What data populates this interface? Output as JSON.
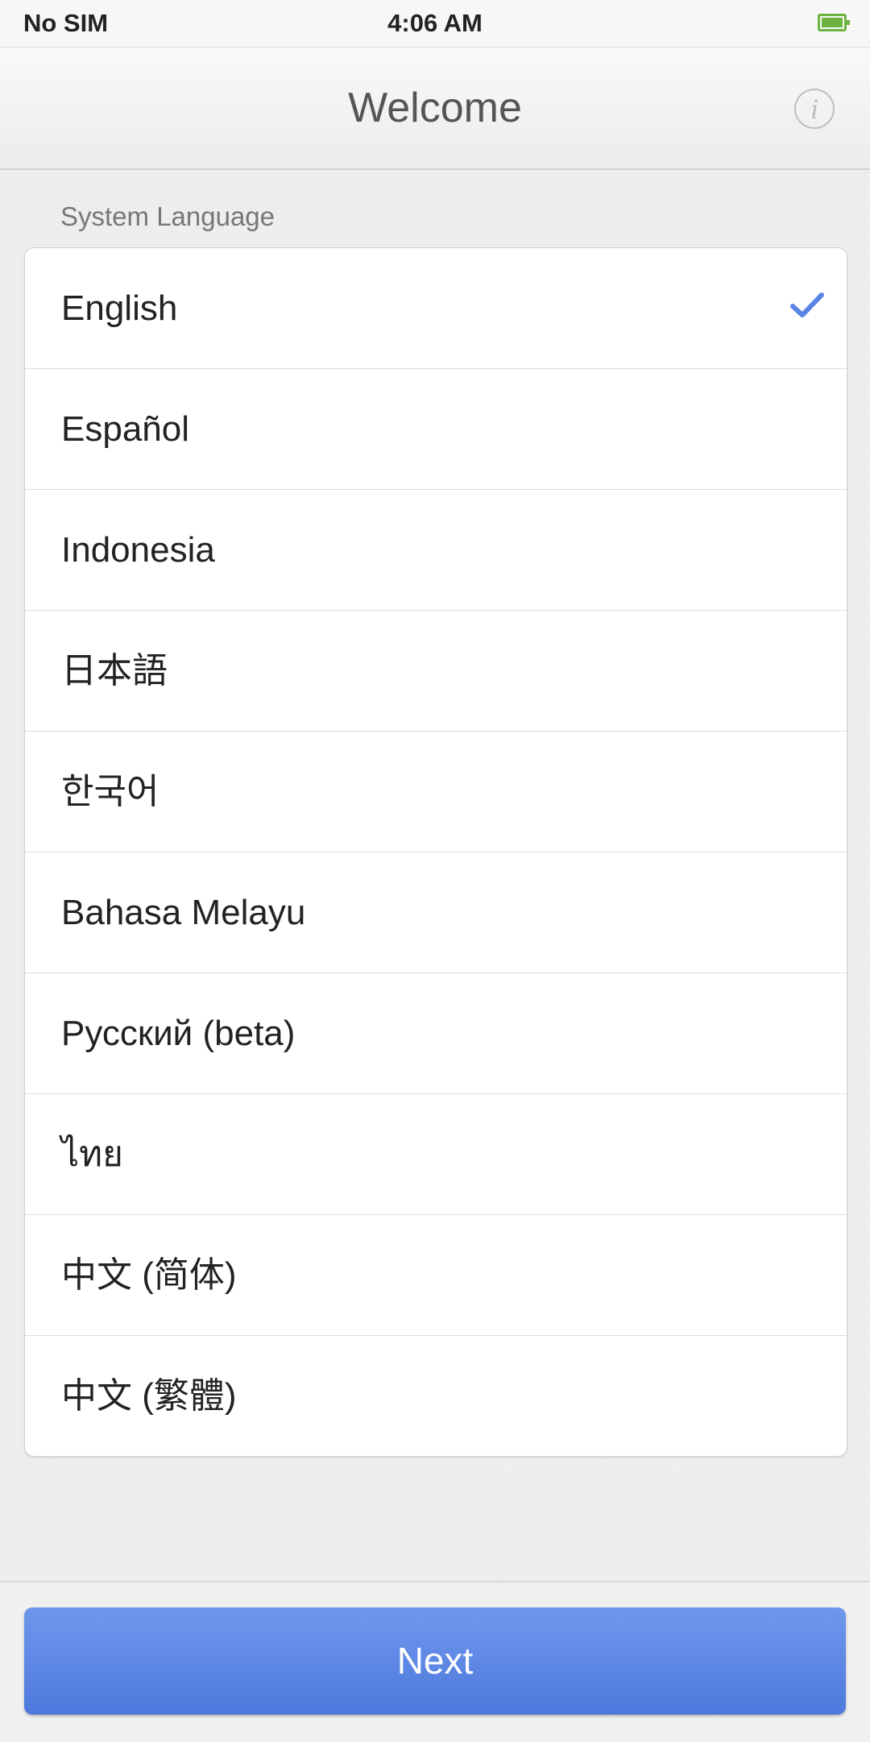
{
  "status_bar": {
    "carrier": "No SIM",
    "time": "4:06 AM",
    "battery_icon": "battery-full-icon",
    "battery_color": "#6db33f"
  },
  "nav_bar": {
    "title": "Welcome",
    "info_label": "i",
    "info_icon": "info-icon"
  },
  "section": {
    "header": "System Language"
  },
  "languages": [
    {
      "label": "English",
      "selected": true
    },
    {
      "label": "Español",
      "selected": false
    },
    {
      "label": "Indonesia",
      "selected": false
    },
    {
      "label": "日本語",
      "selected": false
    },
    {
      "label": "한국어",
      "selected": false
    },
    {
      "label": "Bahasa Melayu",
      "selected": false
    },
    {
      "label": "Русский (beta)",
      "selected": false
    },
    {
      "label": "ไทย",
      "selected": false
    },
    {
      "label": "中文 (简体)",
      "selected": false
    },
    {
      "label": "中文 (繁體)",
      "selected": false
    }
  ],
  "check_icon": "checkmark-icon",
  "accent_color": "#5a83e6",
  "next_button": {
    "label": "Next"
  }
}
